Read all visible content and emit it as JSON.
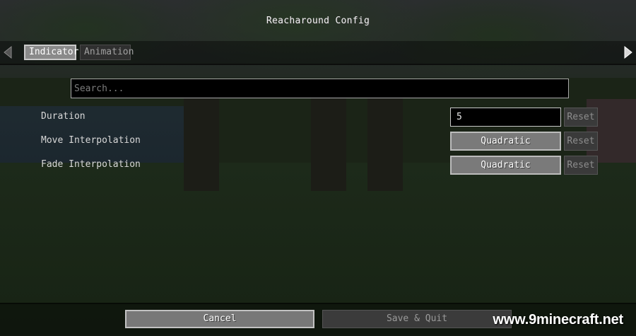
{
  "title": "Reacharound Config",
  "tabs": [
    {
      "label": "Indicator",
      "active": true
    },
    {
      "label": "Animation",
      "active": false
    }
  ],
  "search": {
    "placeholder": "Search..."
  },
  "settings": [
    {
      "label": "Duration",
      "value": "5",
      "reset_label": "Reset"
    },
    {
      "label": "Move Interpolation",
      "value": "Quadratic",
      "reset_label": "Reset"
    },
    {
      "label": "Fade Interpolation",
      "value": "Quadratic",
      "reset_label": "Reset"
    }
  ],
  "footer": {
    "cancel_label": "Cancel",
    "save_label": "Save & Quit"
  },
  "watermark": "www.9minecraft.net",
  "icons": {
    "prev": "triangle-left-icon",
    "next": "triangle-right-icon"
  },
  "colors": {
    "panel": "#000000",
    "button_active": "#7a7a7a",
    "button_disabled": "#3b3b3b"
  }
}
